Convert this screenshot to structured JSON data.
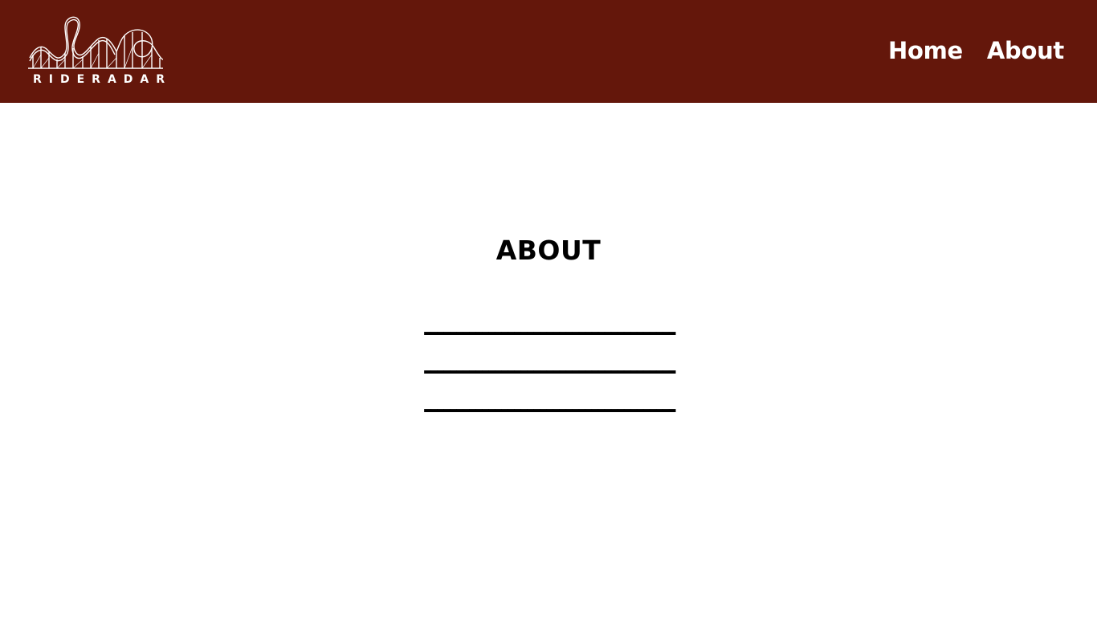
{
  "header": {
    "logo": {
      "icon": "roller-coaster-icon",
      "text": "RIDERADAR"
    },
    "nav": [
      {
        "label": "Home"
      },
      {
        "label": "About"
      }
    ],
    "background_color": "#64170b"
  },
  "main": {
    "title": "ABOUT",
    "lines": [
      "---------------------------------------",
      "---------------------------------------",
      "---------------------------------------"
    ]
  }
}
